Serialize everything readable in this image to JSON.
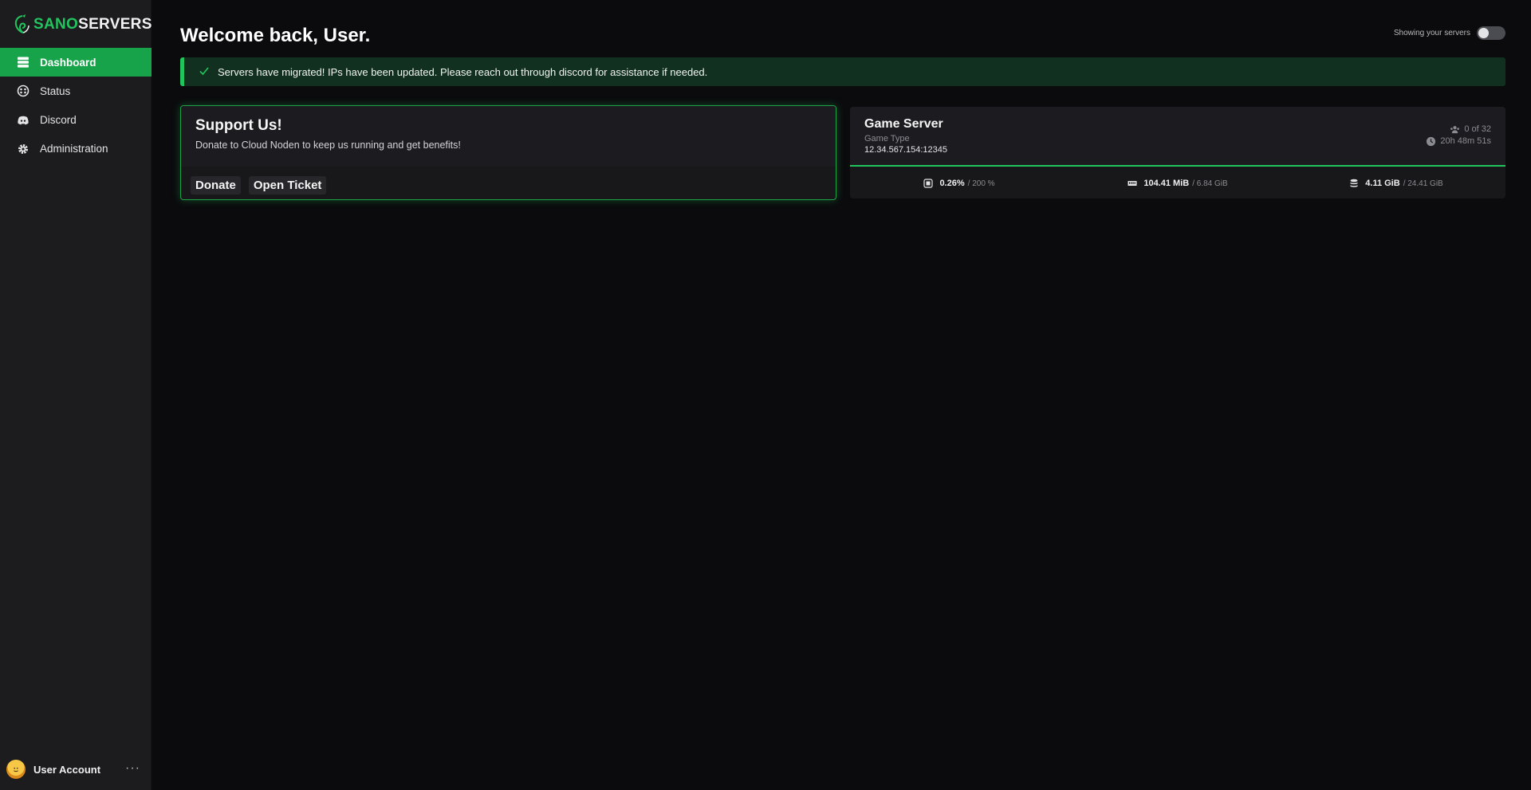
{
  "brand": {
    "part_a": "SANO",
    "part_b": "SERVERS"
  },
  "sidebar": {
    "items": [
      {
        "label": "Dashboard",
        "icon": "server-stack-icon",
        "active": true
      },
      {
        "label": "Status",
        "icon": "status-icon",
        "active": false
      },
      {
        "label": "Discord",
        "icon": "discord-icon",
        "active": false
      },
      {
        "label": "Administration",
        "icon": "gear-icon",
        "active": false
      }
    ],
    "account": {
      "name": "User Account",
      "more": "···"
    }
  },
  "header": {
    "title": "Welcome back, User.",
    "toggle_label": "Showing your servers",
    "toggle_on": false
  },
  "alert": {
    "icon": "check-icon",
    "text": "Servers have migrated! IPs have been updated. Please reach out through discord for assistance if needed."
  },
  "support": {
    "title": "Support Us!",
    "subtitle": "Donate to Cloud Noden to keep us running and get benefits!",
    "donate_label": "Donate",
    "ticket_label": "Open Ticket"
  },
  "server": {
    "name": "Game Server",
    "type": "Game Type",
    "ip": "12.34.567.154:12345",
    "players": "0 of 32",
    "uptime": "20h 48m 51s",
    "cpu": {
      "value": "0.26%",
      "max": "/ 200 %"
    },
    "memory": {
      "value": "104.41 MiB",
      "max": "/ 6.84 GiB"
    },
    "disk": {
      "value": "4.11 GiB",
      "max": "/ 24.41 GiB"
    }
  },
  "colors": {
    "accent": "#22c45e",
    "active_nav": "#17a34a",
    "background": "#0b0b0d",
    "sidebar": "#1c1c1f"
  }
}
